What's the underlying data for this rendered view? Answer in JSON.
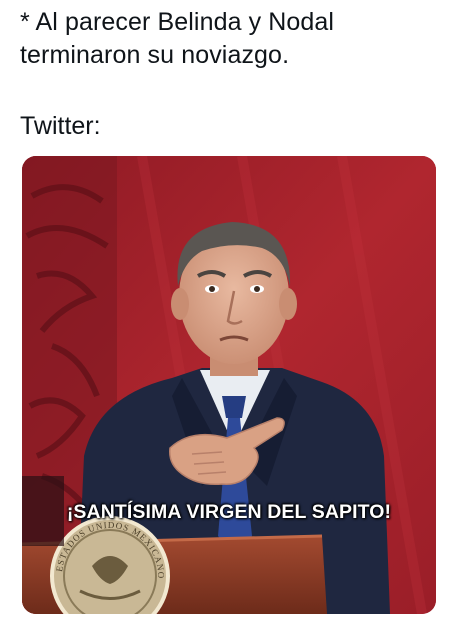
{
  "tweet": {
    "text": "* Al parecer Belinda y Nodal\nterminaron su noviazgo.",
    "subtext": "Twitter:"
  },
  "image": {
    "caption": "¡SANTÍSIMA VIRGEN DEL SAPITO!",
    "seal_text": "ESTADOS UNIDOS MEXICANOS"
  },
  "colors": {
    "background": "#ffffff",
    "text": "#0f1419",
    "backdrop_red": "#a9202a",
    "suit": "#1f2740",
    "tie": "#2e4a9a",
    "podium": "#8a3a25"
  }
}
